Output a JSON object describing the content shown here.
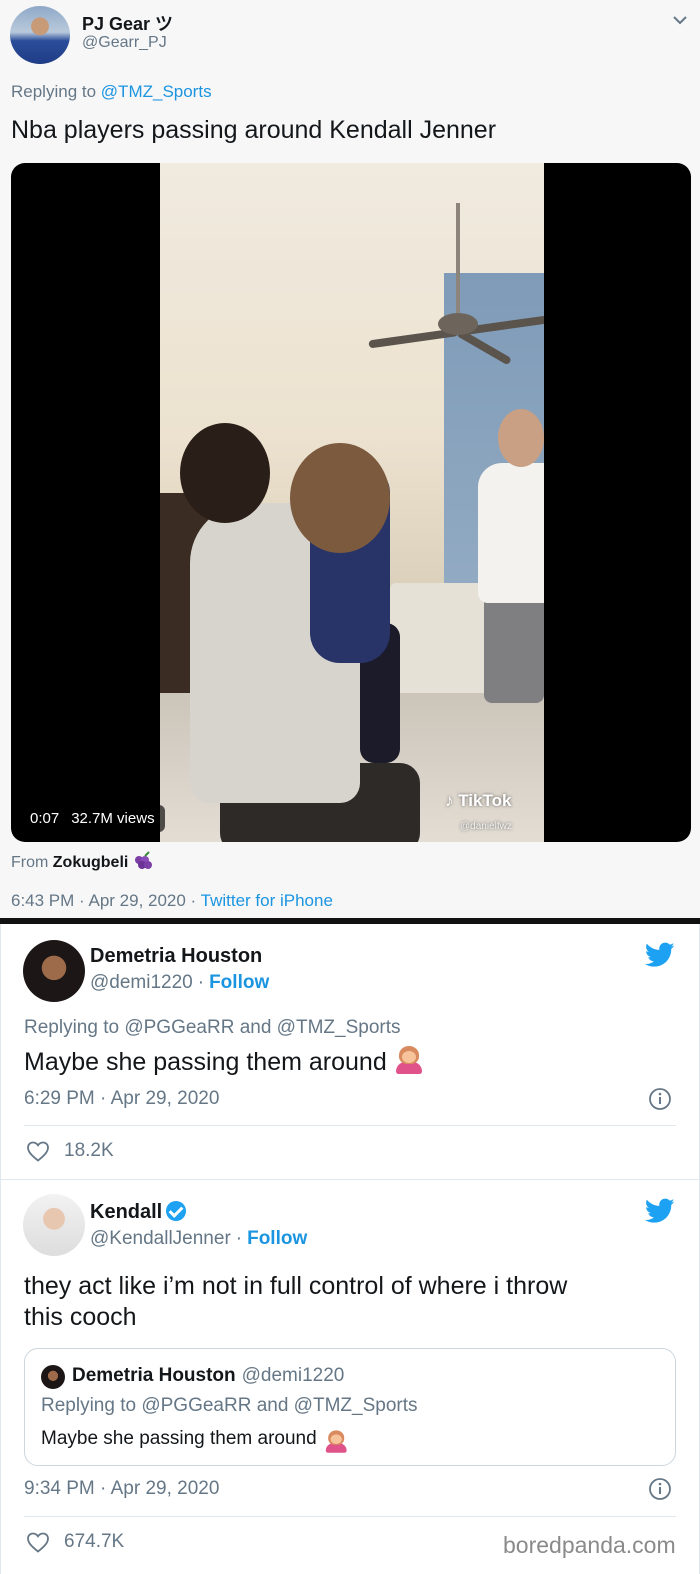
{
  "tweet1": {
    "name": "PJ Gear ツ",
    "handle": "@Gearr_PJ",
    "replying_prefix": "Replying to",
    "replying_to": "@TMZ_Sports",
    "text": "Nba players passing around Kendall Jenner",
    "video": {
      "duration": "0:07",
      "views": "32.7M views",
      "watermark_brand": "TikTok",
      "watermark_handle": "@danielfwz"
    },
    "from_prefix": "From",
    "from_name": "Zokugbeli",
    "time": "6:43 PM · Apr 29, 2020 ·",
    "source": "Twitter for iPhone"
  },
  "tweet2": {
    "name": "Demetria Houston",
    "handle": "@demi1220",
    "follow": "Follow",
    "replying": "Replying to @PGGeaRR and @TMZ_Sports",
    "text": "Maybe she passing them around",
    "time": "6:29 PM · Apr 29, 2020",
    "likes": "18.2K"
  },
  "tweet3": {
    "name": "Kendall",
    "handle": "@KendallJenner",
    "follow": "Follow",
    "text_line1": "they act like i’m not in full control of where i throw",
    "text_line2": "this cooch",
    "quote": {
      "name": "Demetria Houston",
      "handle": "@demi1220",
      "replying": "Replying to @PGGeaRR and @TMZ_Sports",
      "text": "Maybe she passing them around"
    },
    "time": "9:34 PM · Apr 29, 2020",
    "likes": "674.7K"
  },
  "watermark": "boredpanda.com",
  "colors": {
    "link": "#1b95e0",
    "muted": "#657786",
    "twitter_blue": "#1da1f2"
  }
}
